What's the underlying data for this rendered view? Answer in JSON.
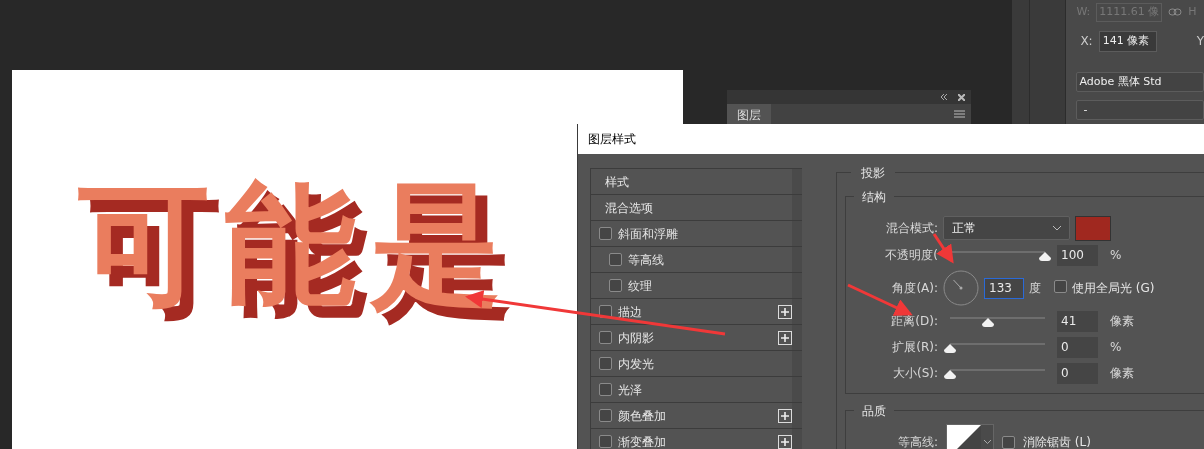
{
  "canvas": {
    "text": "可能是"
  },
  "layers_panel": {
    "tab": "图层"
  },
  "properties_panel": {
    "w_label": "W:",
    "w_value": "1111.61 像",
    "h_label": "H",
    "x_label": "X:",
    "x_value": "141 像素",
    "y_label": "Y",
    "font_family": "Adobe 黑体 Std",
    "font_style": "-"
  },
  "dialog": {
    "title": "图层样式",
    "styles": [
      {
        "kind": "header",
        "label": "样式"
      },
      {
        "kind": "header",
        "label": "混合选项"
      },
      {
        "kind": "check",
        "label": "斜面和浮雕",
        "checked": false,
        "add": false,
        "children": [
          {
            "kind": "check",
            "label": "等高线",
            "checked": false,
            "add": false
          },
          {
            "kind": "check",
            "label": "纹理",
            "checked": false,
            "add": false
          }
        ]
      },
      {
        "kind": "check",
        "label": "描边",
        "checked": false,
        "add": true
      },
      {
        "kind": "check",
        "label": "内阴影",
        "checked": false,
        "add": true
      },
      {
        "kind": "check",
        "label": "内发光",
        "checked": false,
        "add": false
      },
      {
        "kind": "check",
        "label": "光泽",
        "checked": false,
        "add": false
      },
      {
        "kind": "check",
        "label": "颜色叠加",
        "checked": false,
        "add": true
      },
      {
        "kind": "check",
        "label": "渐变叠加",
        "checked": false,
        "add": true
      }
    ],
    "section": "投影",
    "group": "结构",
    "rows": [
      {
        "kind": "blend",
        "label": "混合模式:",
        "value": "正常",
        "color": "#a0281f"
      },
      {
        "kind": "slider",
        "label": "不透明度(",
        "level": 1,
        "value": "100",
        "unit": "%"
      },
      {
        "kind": "angle",
        "label": "角度(A):",
        "value": "133",
        "focused": true,
        "unit": "度",
        "checkbox": {
          "label": "使用全局光 (G)",
          "checked": false
        }
      },
      {
        "kind": "slider",
        "label": "距离(D):",
        "level": 0.4,
        "value": "41",
        "unit": "像素"
      },
      {
        "kind": "slider",
        "label": "扩展(R):",
        "level": 0,
        "value": "0",
        "unit": "%"
      },
      {
        "kind": "slider",
        "label": "大小(S):",
        "level": 0,
        "value": "0",
        "unit": "像素"
      }
    ],
    "quality": {
      "group": "品质",
      "contour_label": "等高线:",
      "antialias": {
        "label": "消除锯齿 (L)",
        "checked": false
      }
    }
  }
}
